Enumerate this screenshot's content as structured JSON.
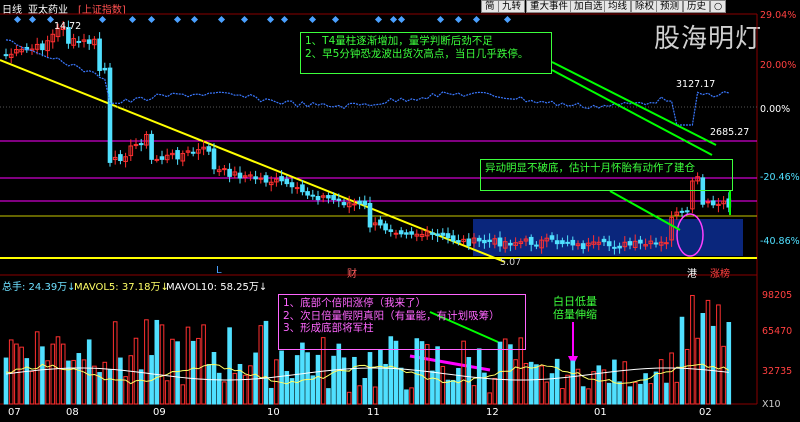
{
  "header": {
    "period": "日线",
    "stock_name": "亚太药业",
    "index_tag": "[上证指数]",
    "toolbar": [
      {
        "label": "简"
      },
      {
        "label": "九转"
      },
      {
        "label": "重大事件"
      },
      {
        "label": "加自选"
      },
      {
        "label": "均线"
      },
      {
        "label": "除权"
      },
      {
        "label": "预测"
      },
      {
        "label": "历史"
      },
      {
        "label": "○"
      }
    ]
  },
  "price_panel": {
    "right_labels": [
      "29.04%",
      "20.00%",
      "0.00%",
      "-20.46%",
      "-40.86%"
    ],
    "annotations": {
      "high": "14.72",
      "low": "5.07",
      "index_high": "3127.17",
      "index_low": "2685.27"
    },
    "markers": {
      "l": "L",
      "cai": "财",
      "gang": "港",
      "zhangting": "涨榜"
    },
    "watermark": "股海明灯",
    "callout_top": "1、T4量柱逐渐增加，量学判断后劲不足\n2、早5分钟恐龙波出货次高点，当日几乎跌停。",
    "callout_mid": "异动明显不破底，估计十月怀胎有动作了建仓"
  },
  "volume_panel": {
    "legend": {
      "total": "总手: 24.39万↓",
      "mavol5": "MAVOL5: 37.18万↓",
      "mavol10": "MAVOL10: 58.25万↓"
    },
    "right_labels": [
      "98205",
      "65470",
      "32735",
      "X10"
    ],
    "callout_left": "1、底部个倍阳涨停（我来了）\n2、次日倍量假阴真阳（有量能，有计划吸筹）\n3、形成底部将军柱",
    "callout_right": "白日低量\n倍量伸缩"
  },
  "x_axis": {
    "months": [
      "07",
      "08",
      "09",
      "10",
      "11",
      "12",
      "01",
      "02"
    ]
  },
  "colors": {
    "up": "#ff3030",
    "down": "#50e0ff",
    "index_line": "#3a78ff",
    "trend": "#ffff00",
    "ma": "#ffff66",
    "ma2": "#ffffff",
    "lev1": "#ff00ff",
    "lev2": "#c8c800",
    "highlight": "#0b2a8a",
    "green_callout": "#00ff00",
    "magenta_callout": "#ff00ff"
  },
  "chart_data": {
    "type": "candlestick",
    "price_range_pct": [
      -40.86,
      29.04
    ],
    "price_extremes": {
      "high": 14.72,
      "low": 5.07
    },
    "volume_ticks": [
      98205,
      65470,
      32735
    ],
    "x_categories": [
      "07",
      "08",
      "09",
      "10",
      "11",
      "12",
      "01",
      "02"
    ]
  }
}
